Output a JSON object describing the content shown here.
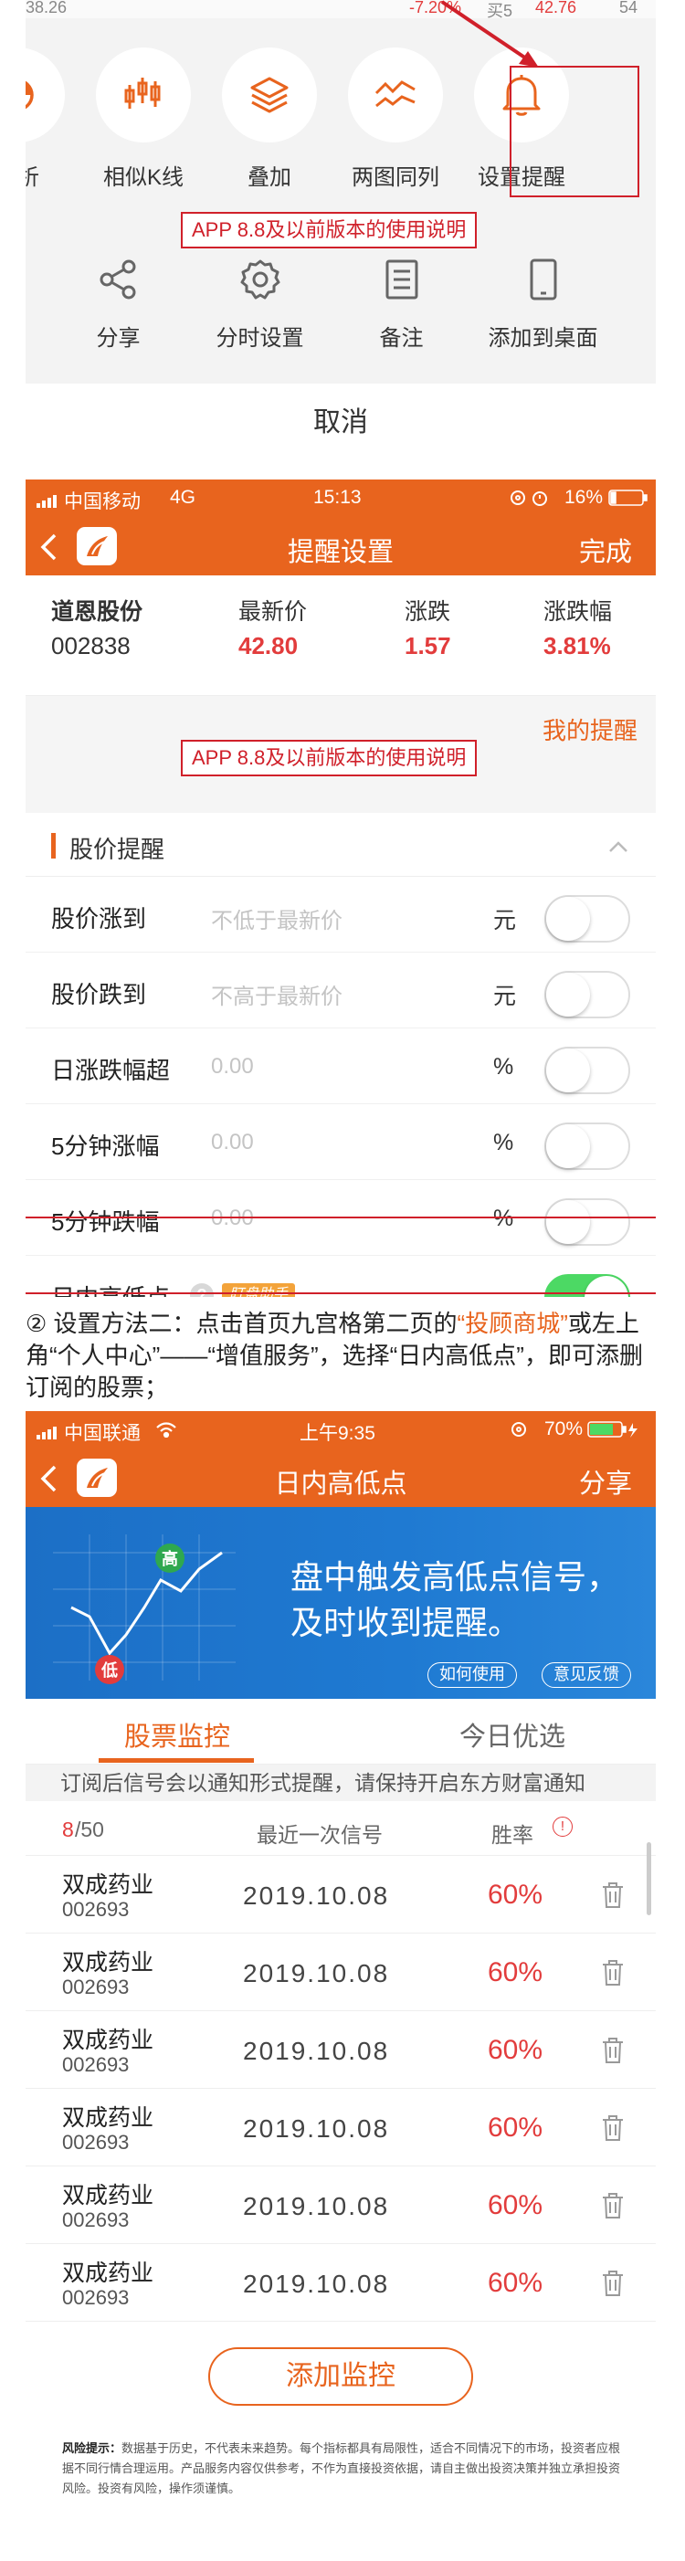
{
  "top_sheet": {
    "ticker": {
      "left": "38.26",
      "change": "-7.20%",
      "buy": "买5",
      "price": "42.76",
      "vol": "54"
    },
    "grid_row1": [
      {
        "label": "分析",
        "icon": "analysis-icon"
      },
      {
        "label": "相似K线",
        "icon": "candlestick-icon"
      },
      {
        "label": "叠加",
        "icon": "layers-icon"
      },
      {
        "label": "两图同列",
        "icon": "dual-chart-icon"
      },
      {
        "label": "设置提醒",
        "icon": "bell-icon"
      }
    ],
    "note": "APP 8.8及以前版本的使用说明",
    "grid_row2": [
      {
        "label": "分享",
        "icon": "share-icon"
      },
      {
        "label": "分时设置",
        "icon": "gear-icon"
      },
      {
        "label": "备注",
        "icon": "note-icon"
      },
      {
        "label": "添加到桌面",
        "icon": "phone-icon"
      }
    ],
    "cancel": "取消"
  },
  "remind_settings": {
    "status": {
      "carrier": "中国移动",
      "network": "4G",
      "time": "15:13",
      "battery": "16%"
    },
    "nav": {
      "title": "提醒设置",
      "done": "完成"
    },
    "quote": {
      "name_label": "道恩股份",
      "code": "002838",
      "price_label": "最新价",
      "price": "42.80",
      "change_label": "涨跌",
      "change": "1.57",
      "pct_label": "涨跌幅",
      "pct": "3.81%"
    },
    "my_remind": "我的提醒",
    "note": "APP 8.8及以前版本的使用说明",
    "section_title": "股价提醒",
    "rows": [
      {
        "name": "股价涨到",
        "placeholder": "不低于最新价",
        "unit": "元",
        "on": false
      },
      {
        "name": "股价跌到",
        "placeholder": "不高于最新价",
        "unit": "元",
        "on": false
      },
      {
        "name": "日涨跌幅超",
        "placeholder": "0.00",
        "unit": "%",
        "on": false
      },
      {
        "name": "5分钟涨幅",
        "placeholder": "0.00",
        "unit": "%",
        "on": false
      },
      {
        "name": "5分钟跌幅",
        "placeholder": "0.00",
        "unit": "%",
        "on": false
      }
    ],
    "highlow_row": {
      "name": "日内高低点",
      "help": "?",
      "badge": "盯盘助手",
      "on": true
    }
  },
  "instruction": {
    "prefix": "② 设置方法二：点击首页九宫格第二页的",
    "link": "“投顾商城”",
    "suffix": "或左上角“个人中心”——“增值服务”，选择“日内高低点”，即可添删订阅的股票；"
  },
  "highlow_page": {
    "status": {
      "carrier": "中国联通",
      "time": "上午9:35",
      "battery": "70%"
    },
    "nav": {
      "title": "日内高低点",
      "share": "分享"
    },
    "banner": {
      "line1": "盘中触发高低点信号，",
      "line2": "及时收到提醒。",
      "high": "高",
      "low": "低",
      "how_to": "如何使用",
      "feedback": "意见反馈"
    },
    "tabs": [
      "股票监控",
      "今日优选"
    ],
    "notice": "订阅后信号会以通知形式提醒，请保持开启东方财富通知",
    "list_head": {
      "count_now": "8",
      "count_total": "/50",
      "signal": "最近一次信号",
      "winrate": "胜率",
      "info": "!"
    },
    "stocks": [
      {
        "name": "双成药业",
        "code": "002693",
        "date": "2019.10.08",
        "rate": "60%"
      },
      {
        "name": "双成药业",
        "code": "002693",
        "date": "2019.10.08",
        "rate": "60%"
      },
      {
        "name": "双成药业",
        "code": "002693",
        "date": "2019.10.08",
        "rate": "60%"
      },
      {
        "name": "双成药业",
        "code": "002693",
        "date": "2019.10.08",
        "rate": "60%"
      },
      {
        "name": "双成药业",
        "code": "002693",
        "date": "2019.10.08",
        "rate": "60%"
      },
      {
        "name": "双成药业",
        "code": "002693",
        "date": "2019.10.08",
        "rate": "60%"
      }
    ],
    "add_button": "添加监控",
    "disclaimer_title": "风险提示：",
    "disclaimer": "数据基于历史，不代表未来趋势。每个指标都具有局限性，适合不同情况下的市场，投资者应根据不同行情合理运用。产品服务内容仅供参考，不作为直接投资依据，请自主做出投资决策并独立承担投资风险。投资有风险，操作须谨慎。"
  },
  "colors": {
    "brand_orange": "#e8641e",
    "annotation_red": "#d0202a",
    "price_red": "#e23c3c",
    "toggle_green": "#4cd964"
  }
}
